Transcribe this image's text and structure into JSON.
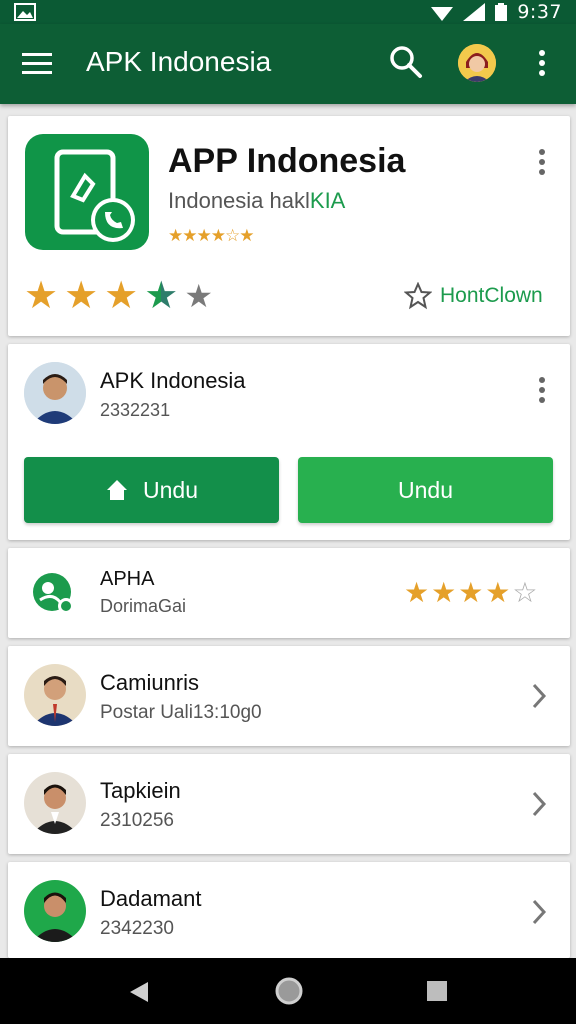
{
  "status_bar": {
    "time": "9:37"
  },
  "app_bar": {
    "title": "APK Indonesia"
  },
  "app_card": {
    "name": "APP Indonesia",
    "developer_plain": "Indonesia ",
    "developer_accent_a": "hakl",
    "developer_accent_b": "KIA",
    "small_stars": "★★★★☆★",
    "rating_stars": 3.5,
    "favorite_label": "HontClown"
  },
  "developer_card": {
    "name": "APK Indonesia",
    "count": "2332231",
    "button_left": "Undu",
    "button_right": "Undu"
  },
  "aph_card": {
    "title": "APHA",
    "subtitle": "DorimaGai",
    "stars": "★★★★",
    "empty_star": "☆"
  },
  "list": [
    {
      "title": "Camiunris",
      "subtitle": "Postar Uali13:10g0"
    },
    {
      "title": "Tapkiein",
      "subtitle": "2310256"
    },
    {
      "title": "Dadamant",
      "subtitle": "2342230"
    }
  ],
  "colors": {
    "primary_dark": "#0d5e35",
    "primary": "#138f4a",
    "primary_light": "#28b04f",
    "star": "#e5a02a"
  },
  "icons": [
    "menu-icon",
    "search-icon",
    "more-vert-icon",
    "star-icon",
    "home-icon",
    "chevron-right-icon",
    "back-icon",
    "home-nav-icon",
    "recents-icon"
  ]
}
